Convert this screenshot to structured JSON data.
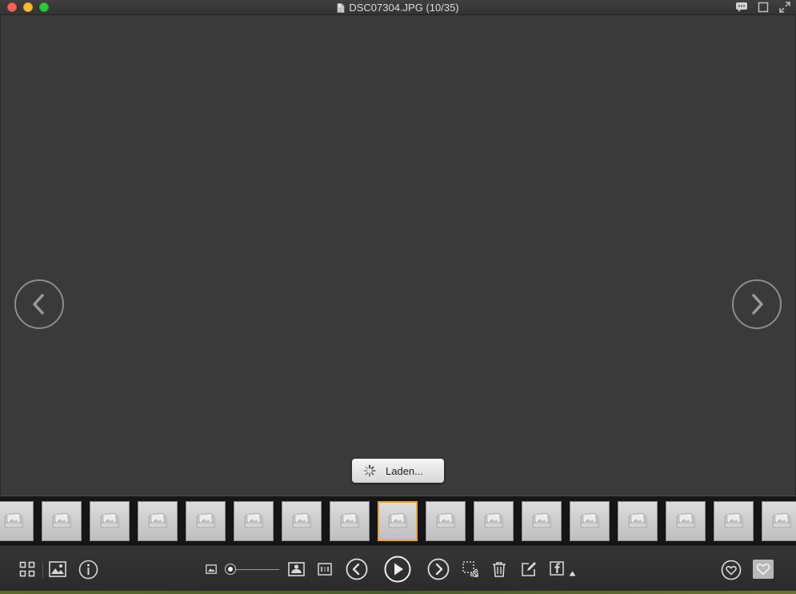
{
  "window": {
    "title": "DSC07304.JPG (10/35)"
  },
  "loading": {
    "label": "Laden..."
  },
  "filmstrip": {
    "thumb_count": 17,
    "selected_index": 8
  },
  "toolbar": {
    "zoom_level": 0.0
  },
  "colors": {
    "accent_selected": "#f0a030",
    "traffic_red": "#fc5f57",
    "traffic_yellow": "#fdbc2e",
    "traffic_green": "#29c83f"
  },
  "icons": {
    "doc": "document-icon",
    "comment": "comment-icon",
    "fullscreen": "fullscreen-icon"
  }
}
